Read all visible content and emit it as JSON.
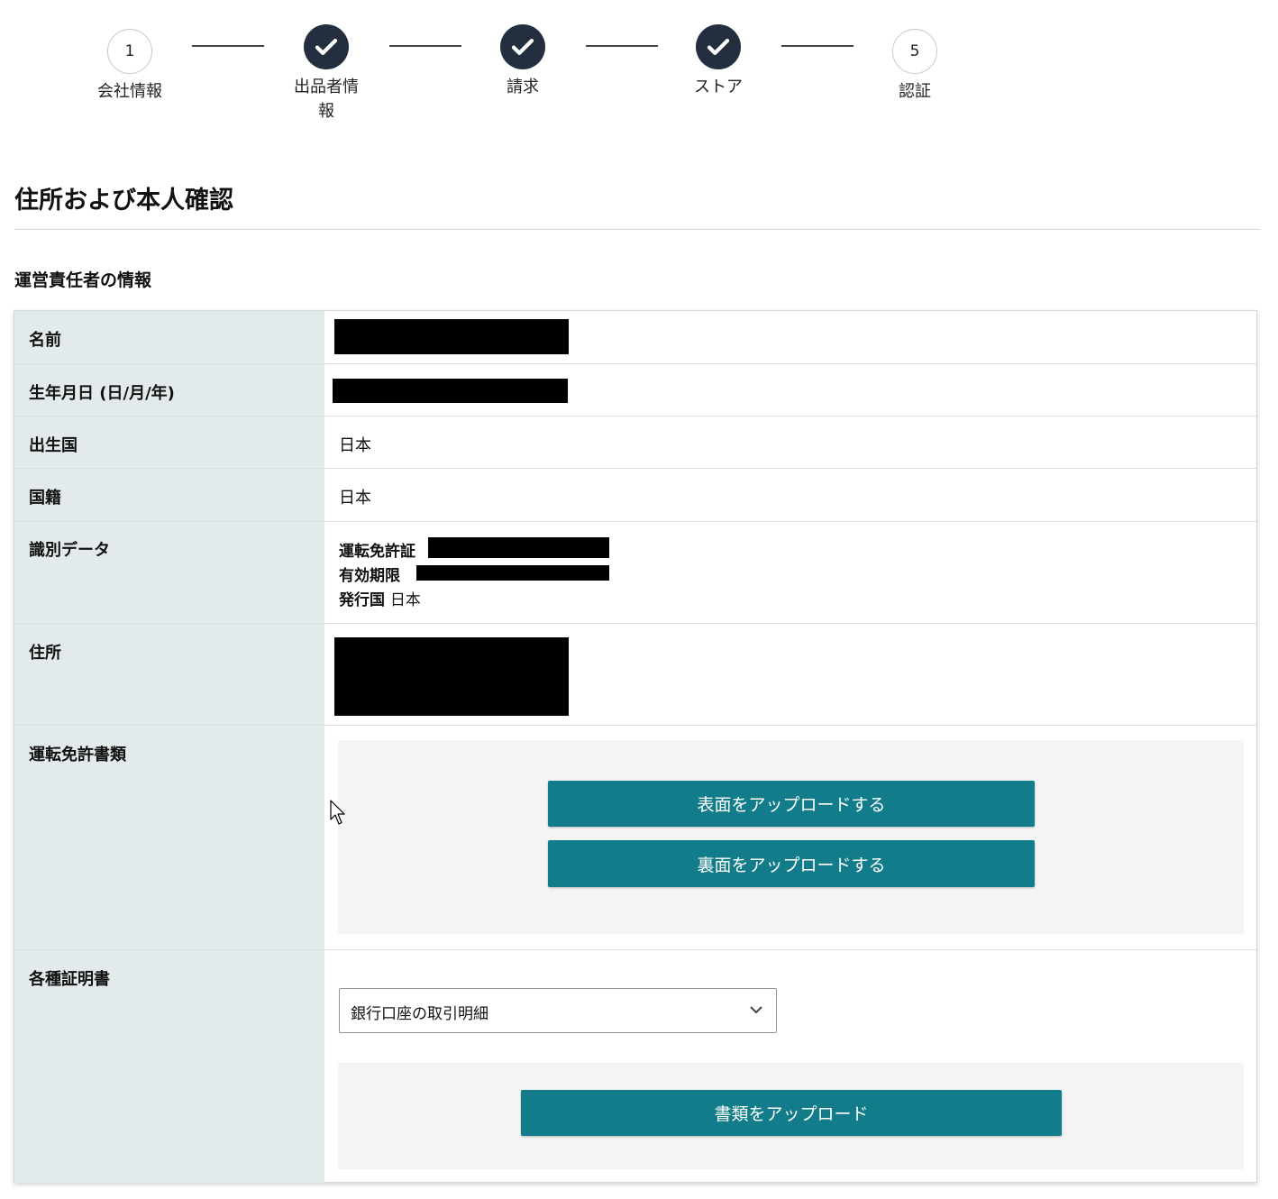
{
  "stepper": {
    "steps": [
      {
        "number": "1",
        "label": "会社情報",
        "state": "pending"
      },
      {
        "number": "",
        "label": "出品者情報",
        "label_line1": "出品者情",
        "label_line2": "報",
        "state": "complete",
        "icon": "check-icon"
      },
      {
        "number": "",
        "label": "請求",
        "state": "complete",
        "icon": "check-icon"
      },
      {
        "number": "",
        "label": "ストア",
        "state": "complete",
        "icon": "check-icon"
      },
      {
        "number": "5",
        "label": "認証",
        "state": "pending"
      }
    ]
  },
  "page_title": "住所および本人確認",
  "section_title": "運営責任者の情報",
  "rows": {
    "name": {
      "label": "名前"
    },
    "dob": {
      "label": "生年月日 (日/月/年)"
    },
    "birth_country": {
      "label": "出生国",
      "value": "日本"
    },
    "nationality": {
      "label": "国籍",
      "value": "日本"
    },
    "identification": {
      "label": "識別データ",
      "license_label": "運転免許証",
      "expiry_label": "有効期限",
      "issuer_label": "発行国",
      "issuer_value": "日本"
    },
    "address": {
      "label": "住所"
    },
    "license_docs": {
      "label": "運転免許書類",
      "upload_front": "表面をアップロードする",
      "upload_back": "裏面をアップロードする"
    },
    "certificates": {
      "label": "各種証明書",
      "document_type_selected": "銀行口座の取引明細",
      "upload_button": "書類をアップロード"
    }
  },
  "colors": {
    "primary_button": "#127c8a",
    "label_column_bg": "#e3eaeb",
    "complete_step": "#232f3e",
    "redaction": "#000000"
  }
}
